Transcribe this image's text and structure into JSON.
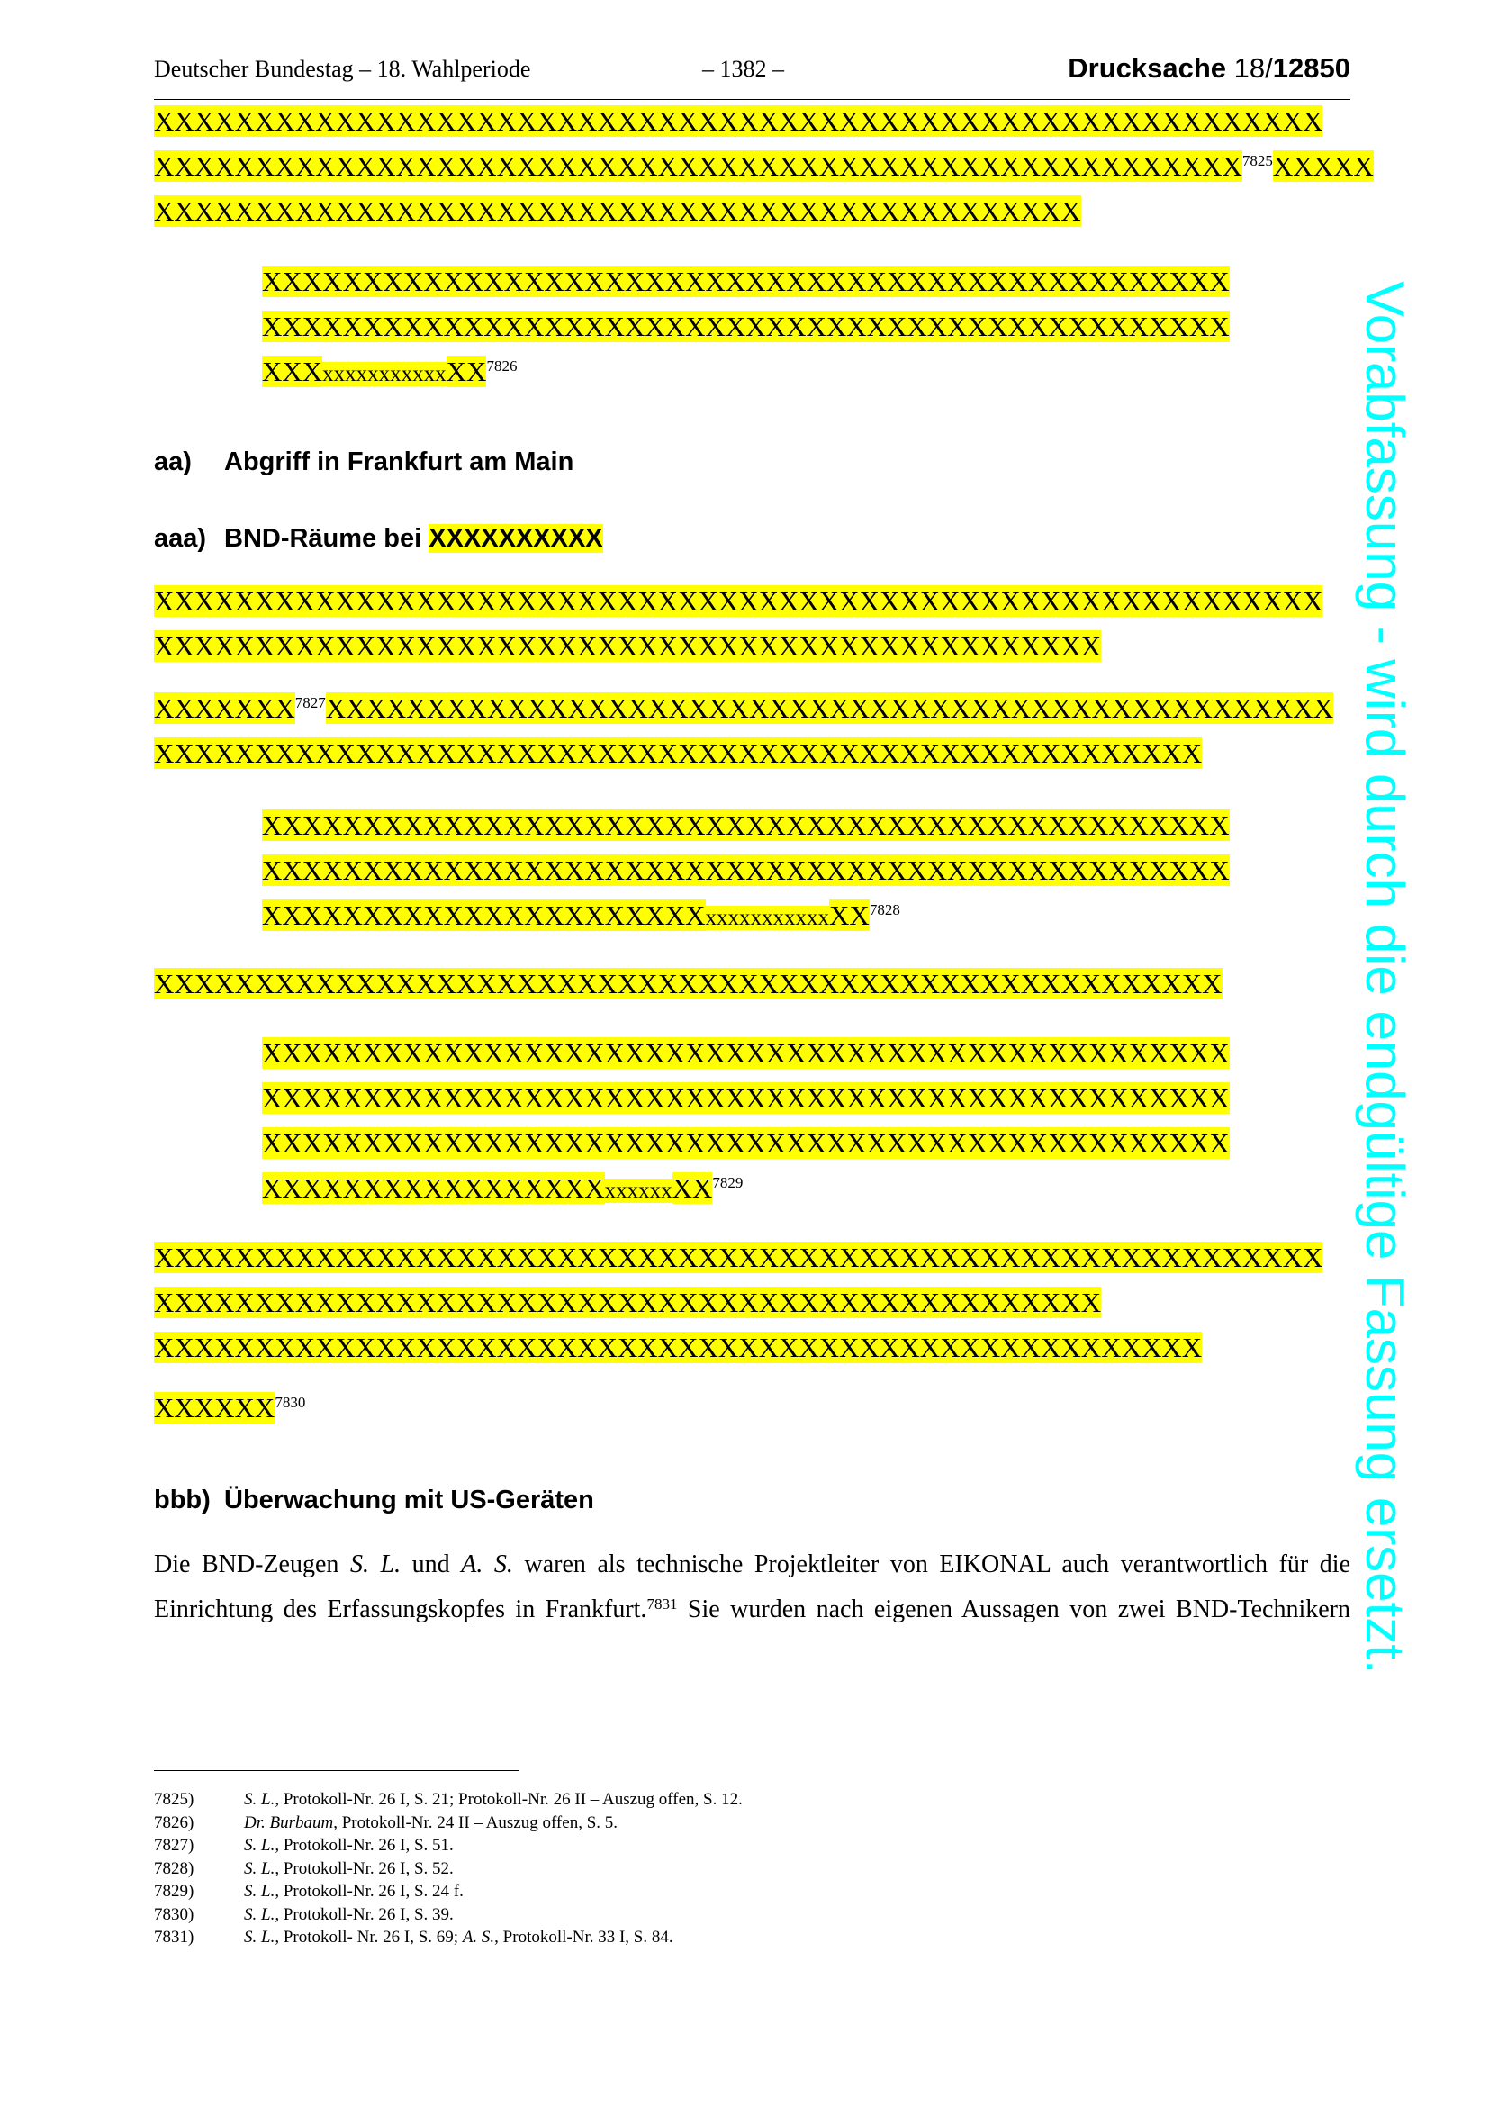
{
  "header": {
    "left": "Deutscher Bundestag – 18. Wahlperiode",
    "center": "– 1382 –",
    "right_prefix": "Drucksache ",
    "right_mid": "18/",
    "right_num": "12850"
  },
  "block1": {
    "l1": "XXXXXXXXXXXXXXXXXXXXXXXXXXXXXXXXXXXXXXXXXXXXXXXXXXXXXXXXXX",
    "l2": "XXXXXXXXXXXXXXXXXXXXXXXXXXXXXXXXXXXXXXXXXXXXXXXXXXXXXX",
    "l2_fn": "7825",
    "l2_tail": "XXXXX",
    "l3": "XXXXXXXXXXXXXXXXXXXXXXXXXXXXXXXXXXXXXXXXXXXXXX"
  },
  "quote1": {
    "l1": "XXXXXXXXXXXXXXXXXXXXXXXXXXXXXXXXXXXXXXXXXXXXXXXX",
    "l2": "XXXXXXXXXXXXXXXXXXXXXXXXXXXXXXXXXXXXXXXXXXXXXXXX",
    "l3a": "XXX",
    "l3b": "xxxxxxxxxxx",
    "l3c": "XX",
    "l3_fn": "7826"
  },
  "heading_aa": {
    "num": "aa)",
    "text": "Abgriff in Frankfurt am Main"
  },
  "heading_aaa": {
    "num": "aaa)",
    "text": "BND-Räume bei ",
    "redacted": "XXXXXXXXXX"
  },
  "block2": {
    "l1": "XXXXXXXXXXXXXXXXXXXXXXXXXXXXXXXXXXXXXXXXXXXXXXXXXXXXXXXXXX",
    "l2": "XXXXXXXXXXXXXXXXXXXXXXXXXXXXXXXXXXXXXXXXXXXXXXX"
  },
  "block3": {
    "l1a": "XXXXXXX",
    "l1_fn": "7827",
    "l1b": "XXXXXXXXXXXXXXXXXXXXXXXXXXXXXXXXXXXXXXXXXXXXXXXXXX",
    "l2": "XXXXXXXXXXXXXXXXXXXXXXXXXXXXXXXXXXXXXXXXXXXXXXXXXXXX"
  },
  "quote2": {
    "l1": "XXXXXXXXXXXXXXXXXXXXXXXXXXXXXXXXXXXXXXXXXXXXXXXX",
    "l2": "XXXXXXXXXXXXXXXXXXXXXXXXXXXXXXXXXXXXXXXXXXXXXXXX",
    "l3a": "XXXXXXXXXXXXXXXXXXXXXX",
    "l3b": "xxxxxxxxxxx",
    "l3c": "XX",
    "l3_fn": "7828"
  },
  "block4": {
    "l1": "XXXXXXXXXXXXXXXXXXXXXXXXXXXXXXXXXXXXXXXXXXXXXXXXXXXXX"
  },
  "quote3": {
    "l1": "XXXXXXXXXXXXXXXXXXXXXXXXXXXXXXXXXXXXXXXXXXXXXXXX",
    "l2": "XXXXXXXXXXXXXXXXXXXXXXXXXXXXXXXXXXXXXXXXXXXXXXXX",
    "l3": "XXXXXXXXXXXXXXXXXXXXXXXXXXXXXXXXXXXXXXXXXXXXXXXX",
    "l4a": "XXXXXXXXXXXXXXXXX",
    "l4b": "xxxxxx",
    "l4c": "XX",
    "l4_fn": "7829"
  },
  "block5": {
    "l1": "XXXXXXXXXXXXXXXXXXXXXXXXXXXXXXXXXXXXXXXXXXXXXXXXXXXXXXXXXX",
    "l2": "XXXXXXXXXXXXXXXXXXXXXXXXXXXXXXXXXXXXXXXXXXXXXXX",
    "l3": "XXXXXXXXXXXXXXXXXXXXXXXXXXXXXXXXXXXXXXXXXXXXXXXXXXXX"
  },
  "block6": {
    "l1": "XXXXXX",
    "l1_fn": "7830"
  },
  "heading_bbb": {
    "num": "bbb)",
    "text": "Überwachung mit US-Geräten"
  },
  "body": {
    "p1": "Die BND-Zeugen ",
    "n1": "S. L.",
    "p2": " und ",
    "n2": "A. S.",
    "p3": " waren als technische Projektleiter von EIKONAL auch verantwortlich für die",
    "p4": "Einrichtung des Erfassungskopfes in Frankfurt.",
    "fn": "7831",
    "p5": " Sie wurden nach eigenen Aussagen von zwei BND-Technikern"
  },
  "footnotes": [
    {
      "num": "7825)",
      "name": "S. L.,",
      "text": " Protokoll-Nr. 26 I, S. 21; Protokoll-Nr. 26 II – Auszug offen, S. 12."
    },
    {
      "num": "7826)",
      "name": "Dr. Burbaum",
      "text": ", Protokoll-Nr. 24 II – Auszug offen, S. 5."
    },
    {
      "num": "7827)",
      "name": "S. L.,",
      "text": " Protokoll-Nr. 26 I, S. 51."
    },
    {
      "num": "7828)",
      "name": "S. L.",
      "text": ", Protokoll-Nr. 26 I, S. 52."
    },
    {
      "num": "7829)",
      "name": "S. L.",
      "text": ", Protokoll-Nr. 26 I, S. 24 f."
    },
    {
      "num": "7830)",
      "name": "S. L.,",
      "text": " Protokoll-Nr. 26 I, S. 39."
    },
    {
      "num": "7831)",
      "name": "S. L.",
      "text": ", Protokoll- Nr. 26 I, S. 69; ",
      "name2": "A. S.",
      "text2": ", Protokoll-Nr. 33 I, S. 84."
    }
  ],
  "watermark": "Vorabfassung - wird durch die endgültige Fassung ersetzt.",
  "colors": {
    "highlight": "#ffff00",
    "watermark": "#00ffff"
  }
}
